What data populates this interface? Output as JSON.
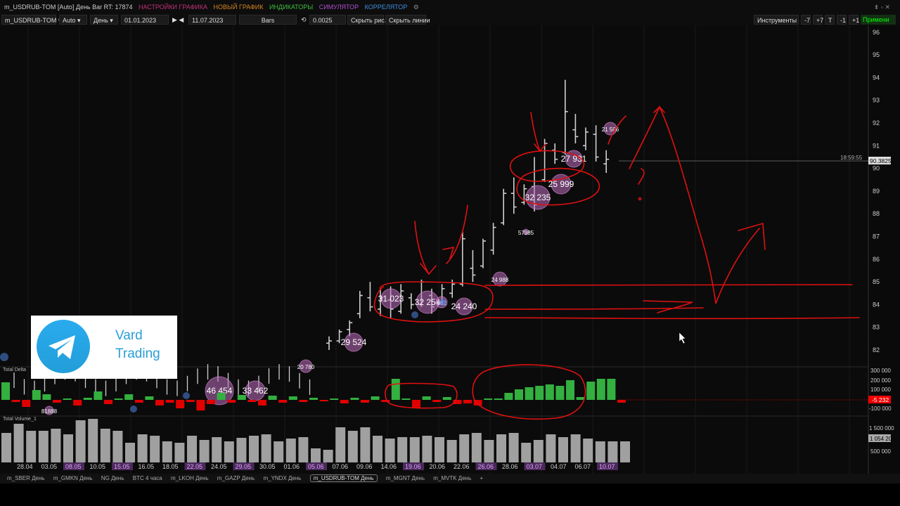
{
  "window": {
    "title": "m_USDRUB-TOM [Auto] День Bar RT: 17874",
    "menu": [
      {
        "label": "НАСТРОЙКИ ГРАФИКА",
        "color": "#c0307a"
      },
      {
        "label": "НОВЫЙ ГРАФИК",
        "color": "#d4851f"
      },
      {
        "label": "ИНДИКАТОРЫ",
        "color": "#3fbf3f"
      },
      {
        "label": "СИМУЛЯТОР",
        "color": "#b04fd0"
      },
      {
        "label": "КОРРЕЛЯТОР",
        "color": "#3f8fe0"
      }
    ]
  },
  "toolbar": {
    "symbol": "m_USDRUB-TOM",
    "mode": "Auto",
    "period": "День",
    "date_from": "01.01.2023",
    "date_to": "11.07.2023",
    "chart_type": "Bars",
    "step": "0.0025",
    "hide_fig": "Скрыть рис.",
    "hide_lines": "Скрыть линии",
    "instruments": "Инструменты",
    "btn_m7": "-7",
    "btn_p7": "+7",
    "btn_t": "T",
    "btn_m1": "-1",
    "btn_p1": "+1",
    "apply": "Примени"
  },
  "price_axis": {
    "labels": [
      "96",
      "95",
      "94",
      "93",
      "92",
      "91",
      "90",
      "89",
      "88",
      "87",
      "86",
      "85",
      "84",
      "83",
      "82"
    ],
    "current_price": "90.3825",
    "current_time": "18:59:55"
  },
  "delta_panel": {
    "title": "Total Delta",
    "axis": [
      "300 000",
      "200 000",
      "100 000",
      "-100 000"
    ],
    "current": "-5 232"
  },
  "volume_panel": {
    "title": "Total Volume_1",
    "axis": [
      "1 500 000",
      "500 000"
    ],
    "current": "1 054 20"
  },
  "chart_data": {
    "type": "bar",
    "annotations": [
      "29 524",
      "31 023",
      "32 254",
      "682",
      "24 240",
      "24 988",
      "57985",
      "32 235",
      "25 999",
      "27 931",
      "21 506",
      "46 454",
      "33 462",
      "81888",
      "20 780"
    ],
    "x_labels": [
      {
        "label": "28.04",
        "hl": false
      },
      {
        "label": "03.05",
        "hl": false
      },
      {
        "label": "08.05",
        "hl": true
      },
      {
        "label": "10.05",
        "hl": false
      },
      {
        "label": "15.05",
        "hl": true
      },
      {
        "label": "16.05",
        "hl": false
      },
      {
        "label": "18.05",
        "hl": false
      },
      {
        "label": "22.05",
        "hl": true
      },
      {
        "label": "24.05",
        "hl": false
      },
      {
        "label": "29.05",
        "hl": true
      },
      {
        "label": "30.05",
        "hl": false
      },
      {
        "label": "01.06",
        "hl": false
      },
      {
        "label": "05.06",
        "hl": true
      },
      {
        "label": "07.06",
        "hl": false
      },
      {
        "label": "09.06",
        "hl": false
      },
      {
        "label": "14.06",
        "hl": false
      },
      {
        "label": "19.06",
        "hl": true
      },
      {
        "label": "20.06",
        "hl": false
      },
      {
        "label": "22.06",
        "hl": false
      },
      {
        "label": "26.06",
        "hl": true
      },
      {
        "label": "28.06",
        "hl": false
      },
      {
        "label": "03.07",
        "hl": true
      },
      {
        "label": "04.07",
        "hl": false
      },
      {
        "label": "06.07",
        "hl": false
      },
      {
        "label": "10.07",
        "hl": true
      }
    ],
    "bars": [
      [
        82.0,
        82.6,
        82.3,
        82.4
      ],
      [
        82.3,
        82.9,
        82.4,
        82.8
      ],
      [
        82.6,
        83.3,
        82.9,
        83.2
      ],
      [
        83.4,
        84.6,
        83.6,
        84.4
      ],
      [
        83.7,
        85.0,
        84.3,
        83.9
      ],
      [
        83.5,
        84.7,
        83.8,
        84.3
      ],
      [
        83.4,
        84.8,
        84.2,
        83.8
      ],
      [
        83.6,
        84.9,
        83.7,
        84.6
      ],
      [
        83.8,
        84.5,
        84.3,
        84.0
      ],
      [
        83.9,
        85.1,
        84.0,
        85.0
      ],
      [
        83.6,
        84.7,
        84.4,
        83.9
      ],
      [
        84.0,
        84.9,
        84.1,
        84.7
      ],
      [
        84.3,
        85.1,
        84.5,
        84.9
      ],
      [
        84.8,
        87.2,
        84.9,
        86.9
      ],
      [
        85.0,
        86.4,
        85.6,
        85.3
      ],
      [
        85.6,
        86.9,
        85.7,
        86.8
      ],
      [
        86.2,
        87.6,
        86.4,
        87.4
      ],
      [
        87.5,
        89.1,
        87.6,
        88.9
      ],
      [
        88.0,
        89.6,
        88.9,
        88.3
      ],
      [
        88.4,
        89.3,
        88.5,
        89.1
      ],
      [
        88.1,
        90.5,
        89.2,
        88.4
      ],
      [
        89.4,
        91.3,
        89.5,
        91.1
      ],
      [
        90.2,
        91.1,
        90.8,
        90.4
      ],
      [
        90.6,
        93.9,
        90.7,
        92.5
      ],
      [
        91.1,
        92.4,
        91.7,
        91.4
      ],
      [
        90.8,
        91.8,
        91.0,
        91.6
      ],
      [
        90.3,
        91.9,
        91.5,
        90.5
      ],
      [
        89.8,
        90.8,
        90.2,
        90.4
      ]
    ]
  }
}
